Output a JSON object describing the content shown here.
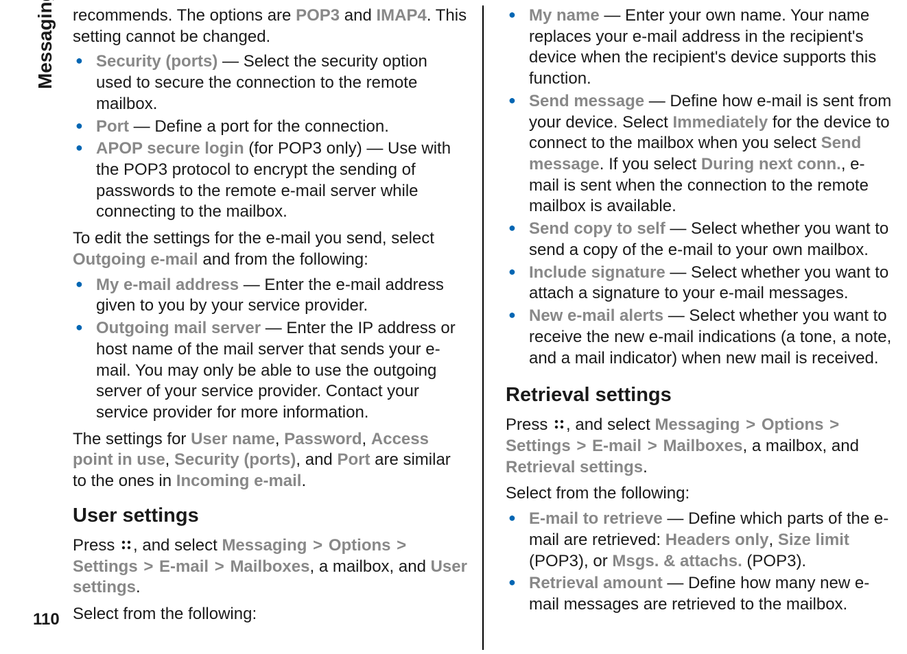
{
  "sidebar": {
    "title": "Messaging",
    "page_number": "110"
  },
  "left_col": {
    "intro_para": {
      "pre": "recommends. The options are ",
      "kw1": "POP3",
      "mid": " and ",
      "kw2": "IMAP4",
      "post": ". This setting cannot be changed."
    },
    "list1": {
      "item1": {
        "label": "Security (ports)",
        "text": " — Select the security option used to secure the connection to the remote mailbox."
      },
      "item2": {
        "label": "Port",
        "text": " — Define a port for the connection."
      },
      "item3": {
        "label": "APOP secure login",
        "text": " (for POP3 only) — Use with the POP3 protocol to encrypt the sending of passwords to the remote e-mail server while connecting to the mailbox."
      }
    },
    "outgoing_intro": {
      "pre": "To edit the settings for the e-mail you send, select ",
      "kw": "Outgoing e-mail",
      "post": " and from the following:"
    },
    "list2": {
      "item1": {
        "label": "My e-mail address",
        "text": " — Enter the e-mail address given to you by your service provider."
      },
      "item2": {
        "label": "Outgoing mail server",
        "text": " — Enter the IP address or host name of the mail server that sends your e-mail. You may only be able to use the outgoing server of your service provider. Contact your service provider for more information."
      }
    },
    "settings_para": {
      "pre": "The settings for ",
      "kw1": "User name",
      "sep1": ", ",
      "kw2": "Password",
      "sep2": ", ",
      "kw3": "Access point in use",
      "sep3": ", ",
      "kw4": "Security (ports)",
      "sep4": ", and ",
      "kw5": "Port",
      "mid": " are similar to the ones in ",
      "kw6": "Incoming e-mail",
      "post": "."
    },
    "user_settings_heading": "User settings",
    "nav_para": {
      "pre": "Press ",
      "mid1": ", and select ",
      "kw1": "Messaging",
      "gt1": ">",
      "kw2": "Options",
      "gt2": ">",
      "kw3": "Settings",
      "gt3": ">",
      "kw4": "E-mail",
      "gt4": ">",
      "kw5": "Mailboxes",
      "mid2": ", a mailbox, and ",
      "kw6": "User settings",
      "post": "."
    },
    "select_from": "Select from the following:"
  },
  "right_col": {
    "list1": {
      "item1": {
        "label": "My name",
        "text": " — Enter your own name. Your name replaces your e-mail address in the recipient's device when the recipient's device supports this function."
      },
      "item2": {
        "label": "Send message",
        "pre": " — Define how e-mail is sent from your device. Select ",
        "kw1": "Immediately",
        "mid1": " for the device to connect to the mailbox when you select ",
        "kw2": "Send message",
        "mid2": ". If you select ",
        "kw3": "During next conn.",
        "post": ", e-mail is sent when the connection to the remote mailbox is available."
      },
      "item3": {
        "label": "Send copy to self",
        "text": " — Select whether you want to send a copy of the e-mail to your own mailbox."
      },
      "item4": {
        "label": "Include signature",
        "text": " — Select whether you want to attach a signature to your e-mail messages."
      },
      "item5": {
        "label": "New e-mail alerts",
        "text": " — Select whether you want to receive the new e-mail indications (a tone, a note, and a mail indicator) when new mail is received."
      }
    },
    "retrieval_heading": "Retrieval settings",
    "nav_para": {
      "pre": "Press ",
      "mid1": ", and select ",
      "kw1": "Messaging",
      "gt1": ">",
      "kw2": "Options",
      "gt2": ">",
      "kw3": "Settings",
      "gt3": ">",
      "kw4": "E-mail",
      "gt4": ">",
      "kw5": "Mailboxes",
      "mid2": ", a mailbox, and ",
      "kw6": "Retrieval settings",
      "post": "."
    },
    "select_from": "Select from the following:",
    "list2": {
      "item1": {
        "label": "E-mail to retrieve",
        "pre": " — Define which parts of the e-mail are retrieved: ",
        "kw1": "Headers only",
        "sep1": ", ",
        "kw2": "Size limit",
        "mid": " (POP3), or ",
        "kw3": "Msgs. & attachs.",
        "post": " (POP3)."
      },
      "item2": {
        "label": "Retrieval amount",
        "text": " — Define how many new e-mail messages are retrieved to the mailbox."
      }
    }
  }
}
